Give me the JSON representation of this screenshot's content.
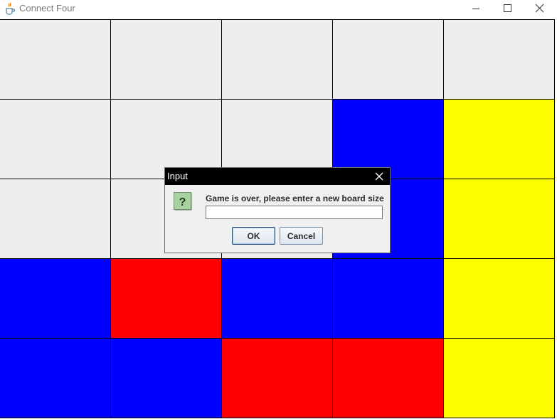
{
  "window": {
    "title": "Connect Four",
    "icon": "java-cup-icon",
    "controls": [
      "minimize-icon",
      "maximize-icon",
      "close-icon"
    ]
  },
  "board": {
    "rows": 5,
    "columns": 5,
    "colors": {
      "empty": "#eeeeee",
      "blue": "#0000ff",
      "red": "#ff0000",
      "yellow": "#ffff00"
    },
    "cells": [
      [
        "empty",
        "empty",
        "empty",
        "empty",
        "empty"
      ],
      [
        "empty",
        "empty",
        "empty",
        "blue",
        "yellow"
      ],
      [
        "empty",
        "empty",
        "empty",
        "blue",
        "yellow"
      ],
      [
        "blue",
        "red",
        "blue",
        "blue",
        "yellow"
      ],
      [
        "blue",
        "blue",
        "red",
        "red",
        "yellow"
      ]
    ]
  },
  "dialog": {
    "title": "Input",
    "icon": "question-icon",
    "message": "Game is over, please enter a new board size",
    "input_value": "",
    "ok_label": "OK",
    "cancel_label": "Cancel"
  }
}
